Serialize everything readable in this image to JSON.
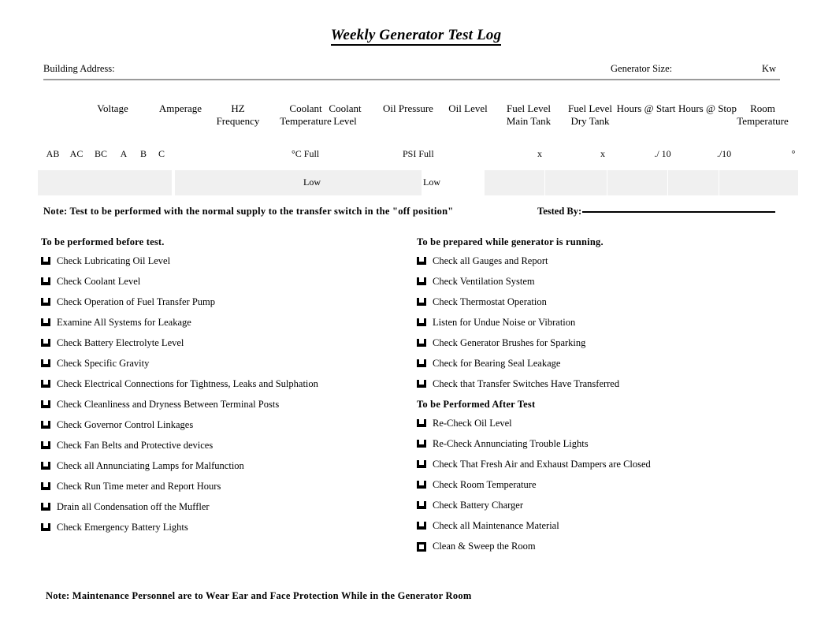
{
  "document": {
    "title": "Weekly Generator Test Log"
  },
  "header": {
    "building_address_label": "Building Address:",
    "generator_size_label": "Generator Size:",
    "kw_unit": "Kw"
  },
  "table": {
    "columns": [
      {
        "line1": "Voltage",
        "line2": ""
      },
      {
        "line1": "Amperage",
        "line2": ""
      },
      {
        "line1": "HZ",
        "line2": "Frequency"
      },
      {
        "line1": "Coolant",
        "line2": "Temperature"
      },
      {
        "line1": "Coolant",
        "line2": "Level"
      },
      {
        "line1": "Oil Pressure",
        "line2": ""
      },
      {
        "line1": "Oil Level",
        "line2": ""
      },
      {
        "line1": "Fuel Level",
        "line2": "Main Tank"
      },
      {
        "line1": "Fuel Level",
        "line2": "Dry Tank"
      },
      {
        "line1": "Hours @ Start",
        "line2": ""
      },
      {
        "line1": "Hours @ Stop",
        "line2": ""
      },
      {
        "line1": "Room",
        "line2": "Temperature"
      }
    ],
    "subheaders": [
      "AB",
      "AC",
      "BC",
      "A",
      "B",
      "C",
      "°C Full",
      "PSI Full",
      "x",
      "x",
      "./ 10",
      "./10",
      "°"
    ],
    "subheaders_secondary": [
      "Low",
      "Low"
    ]
  },
  "notes": {
    "test_note": "Note: Test to be performed with the normal supply to the transfer switch in the  \"off position\"",
    "tested_by_label": "Tested By:",
    "bottom_note": "Note: Maintenance Personnel are to Wear Ear and Face Protection While in the  Generator Room"
  },
  "checklists": {
    "before_test": {
      "heading": "To be performed before test.",
      "items": [
        "Check Lubricating Oil Level",
        "Check Coolant Level",
        "Check Operation of Fuel Transfer Pump",
        "Examine All Systems for Leakage",
        "Check Battery Electrolyte Level",
        "Check Specific Gravity",
        "Check Electrical Connections for Tightness, Leaks and Sulphation",
        "Check Cleanliness and Dryness Between Terminal Posts",
        "Check Governor Control Linkages",
        "Check Fan Belts and Protective devices",
        "Check all Annunciating Lamps for Malfunction",
        "Check Run Time meter and Report Hours",
        "Drain all Condensation off the Muffler",
        "Check Emergency Battery Lights"
      ]
    },
    "while_running": {
      "heading": "To be prepared while generator is running.",
      "items": [
        "Check all Gauges and Report",
        "Check Ventilation System",
        "Check Thermostat Operation",
        "Listen for Undue Noise or Vibration",
        "Check Generator Brushes for Sparking",
        "Check for Bearing Seal Leakage",
        "Check that Transfer Switches Have Transferred"
      ]
    },
    "after_test": {
      "heading": "To be Performed After Test",
      "items": [
        "Re-Check Oil Level",
        "Re-Check Annunciating Trouble Lights",
        "Check That Fresh Air and Exhaust Dampers are Closed",
        "Check Room Temperature",
        "Check Battery Charger",
        "Check all Maintenance Material",
        "Clean & Sweep the Room"
      ]
    }
  },
  "colors": {
    "field_fill": "#f0f0f0",
    "rule": "#9a9a9a",
    "text": "#000000"
  }
}
